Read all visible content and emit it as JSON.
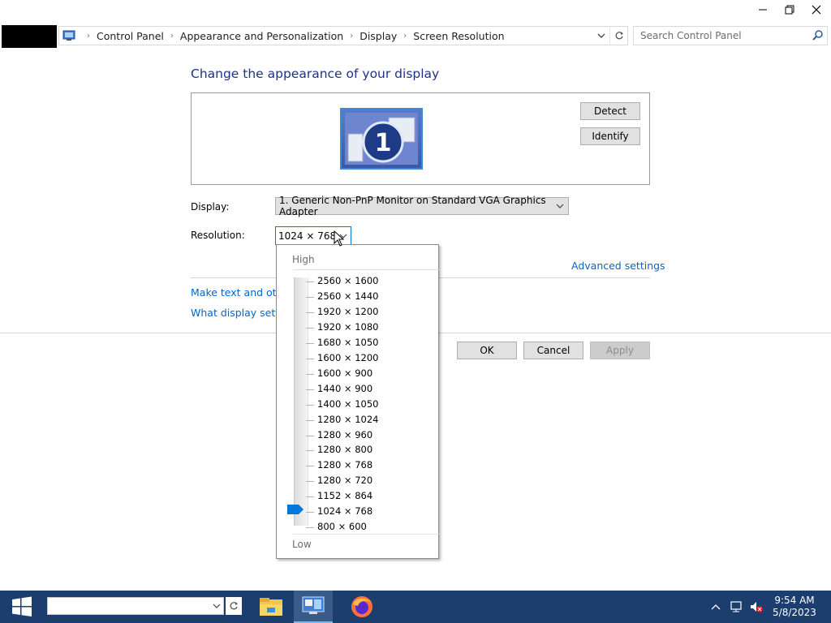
{
  "window": {
    "controls": [
      "minimize-icon",
      "restore-icon",
      "close-icon"
    ]
  },
  "address": {
    "crumbs": [
      "Control Panel",
      "Appearance and Personalization",
      "Display",
      "Screen Resolution"
    ],
    "search_placeholder": "Search Control Panel"
  },
  "main": {
    "title": "Change the appearance of your display",
    "monitor_number": "1",
    "detect_label": "Detect",
    "identify_label": "Identify",
    "display_label": "Display:",
    "display_value": "1. Generic Non-PnP Monitor on Standard VGA Graphics Adapter",
    "resolution_label": "Resolution:",
    "resolution_value": "1024 × 768",
    "advanced_link": "Advanced settings",
    "link_text_size": "Make text and other",
    "link_display_settings": "What display setting",
    "ok_label": "OK",
    "cancel_label": "Cancel",
    "apply_label": "Apply"
  },
  "resolution_popup": {
    "high_label": "High",
    "low_label": "Low",
    "options": [
      "2560 × 1600",
      "2560 × 1440",
      "1920 × 1200",
      "1920 × 1080",
      "1680 × 1050",
      "1600 × 1200",
      "1600 × 900",
      "1440 × 900",
      "1400 × 1050",
      "1280 × 1024",
      "1280 × 960",
      "1280 × 800",
      "1280 × 768",
      "1280 × 720",
      "1152 × 864",
      "1024 × 768",
      "800 × 600"
    ],
    "selected": "1024 × 768"
  },
  "taskbar": {
    "time": "9:54 AM",
    "date": "5/8/2023",
    "apps": [
      "file-explorer-icon",
      "control-panel-icon",
      "firefox-icon"
    ]
  },
  "colors": {
    "accent": "#0078d7",
    "title": "#1e3287",
    "link": "#0066cc",
    "taskbar": "#1b3e6f"
  }
}
